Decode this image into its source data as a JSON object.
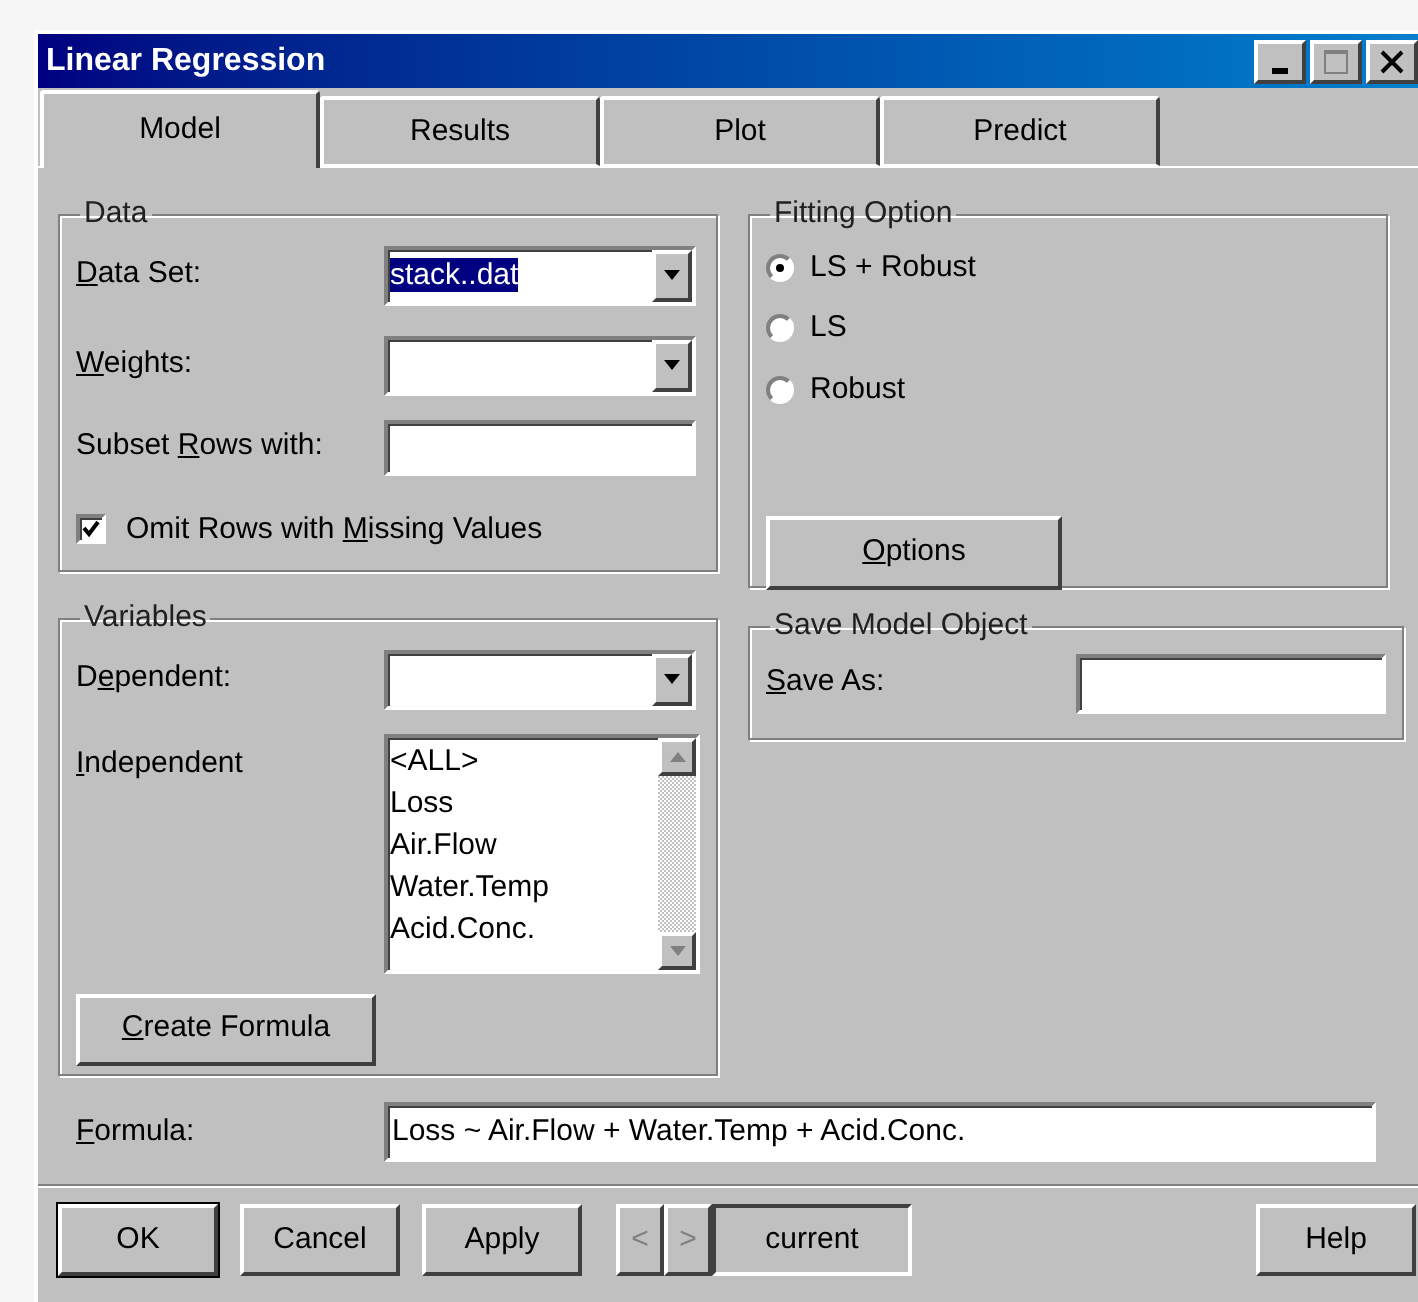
{
  "window": {
    "title": "Linear Regression"
  },
  "tabs": [
    {
      "label": "Model",
      "selected": true
    },
    {
      "label": "Results",
      "selected": false
    },
    {
      "label": "Plot",
      "selected": false
    },
    {
      "label": "Predict",
      "selected": false
    }
  ],
  "data_group": {
    "title": "Data",
    "data_set": {
      "label": {
        "parts": [
          {
            "text": "D",
            "underlined": true
          },
          {
            "text": "ata Set:",
            "underlined": false
          }
        ]
      },
      "value": "stack..dat",
      "selected": true
    },
    "weights": {
      "label": {
        "parts": [
          {
            "text": "W",
            "underlined": true
          },
          {
            "text": "eights:",
            "underlined": false
          }
        ]
      }
    },
    "subset_rows": {
      "label": {
        "parts": [
          {
            "text": "Subset ",
            "underlined": false
          },
          {
            "text": "R",
            "underlined": true
          },
          {
            "text": "ows with:",
            "underlined": false
          }
        ]
      }
    },
    "omit_missing": {
      "label": {
        "parts": [
          {
            "text": "Omit Rows with ",
            "underlined": false
          },
          {
            "text": "M",
            "underlined": true
          },
          {
            "text": "issing Values",
            "underlined": false
          }
        ]
      },
      "checked": true
    }
  },
  "fitting_option": {
    "title": "Fitting Option",
    "options": [
      {
        "label": "LS + Robust",
        "selected": true
      },
      {
        "label": "LS",
        "selected": false
      },
      {
        "label": "Robust",
        "selected": false
      }
    ],
    "options_button": {
      "parts": [
        {
          "text": "O",
          "underlined": true
        },
        {
          "text": "ptions",
          "underlined": false
        }
      ]
    }
  },
  "variables_group": {
    "title": "Variables",
    "dependent": {
      "label": {
        "parts": [
          {
            "text": "D",
            "underlined": false
          },
          {
            "text": "e",
            "underlined": true
          },
          {
            "text": "pendent:",
            "underlined": false
          }
        ]
      }
    },
    "independent": {
      "label": {
        "parts": [
          {
            "text": "I",
            "underlined": true
          },
          {
            "text": "ndependent",
            "underlined": false
          }
        ]
      },
      "items": [
        "<ALL>",
        "Loss",
        "Air.Flow",
        "Water.Temp",
        "Acid.Conc."
      ]
    },
    "create_formula_button": {
      "parts": [
        {
          "text": "C",
          "underlined": true
        },
        {
          "text": "reate Formula",
          "underlined": false
        }
      ]
    }
  },
  "save_model_object": {
    "title": "Save Model Object",
    "save_as": {
      "label": {
        "parts": [
          {
            "text": "S",
            "underlined": true
          },
          {
            "text": "ave As:",
            "underlined": false
          }
        ]
      }
    }
  },
  "formula": {
    "label": {
      "parts": [
        {
          "text": "F",
          "underlined": true
        },
        {
          "text": "ormula:",
          "underlined": false
        }
      ]
    },
    "value": "Loss ~ Air.Flow + Water.Temp + Acid.Conc."
  },
  "buttons": [
    {
      "label": "OK",
      "default": true
    },
    {
      "label": "Cancel",
      "default": false
    },
    {
      "label": "Apply",
      "default": false
    }
  ],
  "navigator": {
    "prev": {
      "label": "<",
      "disabled": true
    },
    "next": {
      "label": ">",
      "disabled": true
    },
    "value": "current"
  },
  "help_button": {
    "label": "Help"
  }
}
